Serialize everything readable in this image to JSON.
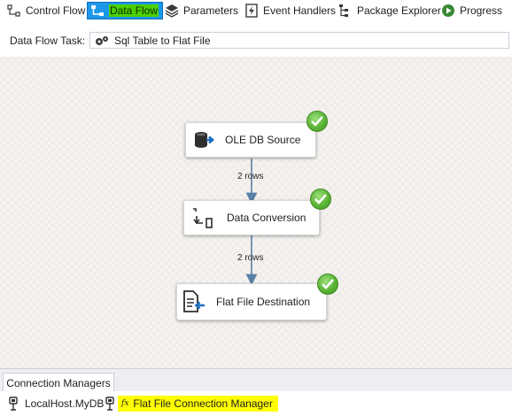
{
  "tabs": [
    {
      "label": "Control Flow",
      "icon": "control-flow-icon",
      "active": false
    },
    {
      "label": "Data Flow",
      "icon": "data-flow-icon",
      "active": true
    },
    {
      "label": "Parameters",
      "icon": "parameters-icon",
      "active": false
    },
    {
      "label": "Event Handlers",
      "icon": "event-handlers-icon",
      "active": false
    },
    {
      "label": "Package Explorer",
      "icon": "package-explorer-icon",
      "active": false
    },
    {
      "label": "Progress",
      "icon": "progress-icon",
      "active": false
    }
  ],
  "task": {
    "label": "Data Flow Task:",
    "value": "Sql Table to Flat File"
  },
  "components": [
    {
      "label": "OLE DB Source",
      "icon": "database-source-icon",
      "status": "success"
    },
    {
      "label": "Data Conversion",
      "icon": "data-conversion-icon",
      "status": "success"
    },
    {
      "label": "Flat File Destination",
      "icon": "flat-file-destination-icon",
      "status": "success"
    }
  ],
  "paths": [
    {
      "rows_label": "2 rows"
    },
    {
      "rows_label": "2 rows"
    }
  ],
  "connection_managers": {
    "tab_label": "Connection Managers",
    "items": [
      {
        "label": "LocalHost.MyDB",
        "icon": "oledb-connection-icon",
        "highlighted": false
      },
      {
        "label": "Flat File Connection Manager",
        "icon": "flat-file-connection-icon",
        "expression_marker": "fx",
        "highlighted": true
      }
    ]
  },
  "colors": {
    "active_tab_bg": "#1c97ea",
    "active_tab_label_highlight": "#4cd100",
    "status_success": "#5cb436",
    "highlight": "#ffff00",
    "canvas_bg": "#f5f2ef",
    "arrow": "#5a7fa8"
  }
}
